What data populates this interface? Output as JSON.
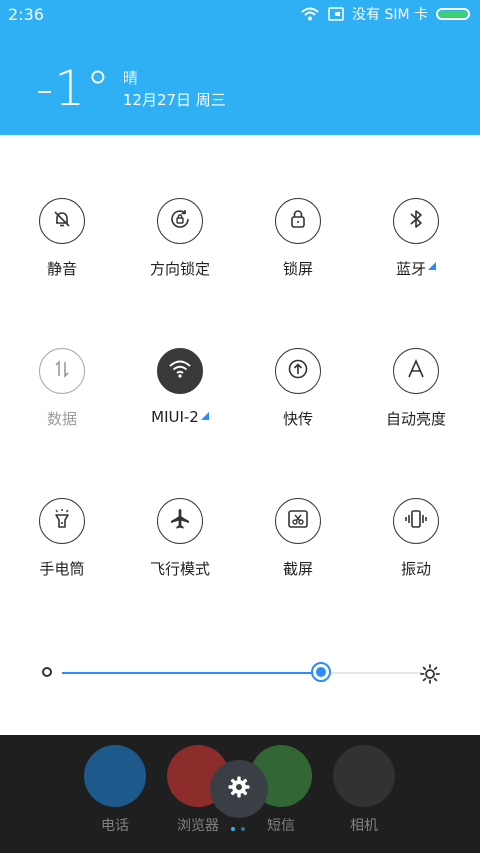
{
  "status_bar": {
    "time": "2:36",
    "carrier": "没有 SIM 卡",
    "icons": [
      "wifi-icon",
      "sim-icon",
      "battery-icon"
    ]
  },
  "weather": {
    "temperature": "-1°",
    "condition": "晴",
    "date": "12月27日 周三"
  },
  "tiles": [
    {
      "label": "静音",
      "icon": "bell-off-icon",
      "state": "off"
    },
    {
      "label": "方向锁定",
      "icon": "rotation-lock-icon",
      "state": "off"
    },
    {
      "label": "锁屏",
      "icon": "lock-icon",
      "state": "off"
    },
    {
      "label": "蓝牙",
      "icon": "bluetooth-icon",
      "state": "off",
      "has_detail": true
    },
    {
      "label": "数据",
      "icon": "data-icon",
      "state": "disabled"
    },
    {
      "label": "MIUI-2",
      "icon": "wifi-icon",
      "state": "on",
      "has_detail": true
    },
    {
      "label": "快传",
      "icon": "transfer-icon",
      "state": "off"
    },
    {
      "label": "自动亮度",
      "icon": "auto-brightness-icon",
      "state": "off"
    },
    {
      "label": "手电筒",
      "icon": "flashlight-icon",
      "state": "off"
    },
    {
      "label": "飞行模式",
      "icon": "airplane-icon",
      "state": "off"
    },
    {
      "label": "截屏",
      "icon": "screenshot-icon",
      "state": "off"
    },
    {
      "label": "振动",
      "icon": "vibrate-icon",
      "state": "off"
    }
  ],
  "brightness": {
    "level": 0.72
  },
  "dock": {
    "apps": [
      {
        "label": "电话",
        "icon": "phone-icon",
        "color": "#1e88e5"
      },
      {
        "label": "浏览器",
        "icon": "browser-icon",
        "color": "#e53935"
      },
      {
        "label": "短信",
        "icon": "sms-icon",
        "color": "#43a047"
      },
      {
        "label": "相机",
        "icon": "camera-icon",
        "color": "#424242"
      }
    ]
  },
  "colors": {
    "accent": "#2a8cff",
    "header": "#2fb0f5"
  }
}
